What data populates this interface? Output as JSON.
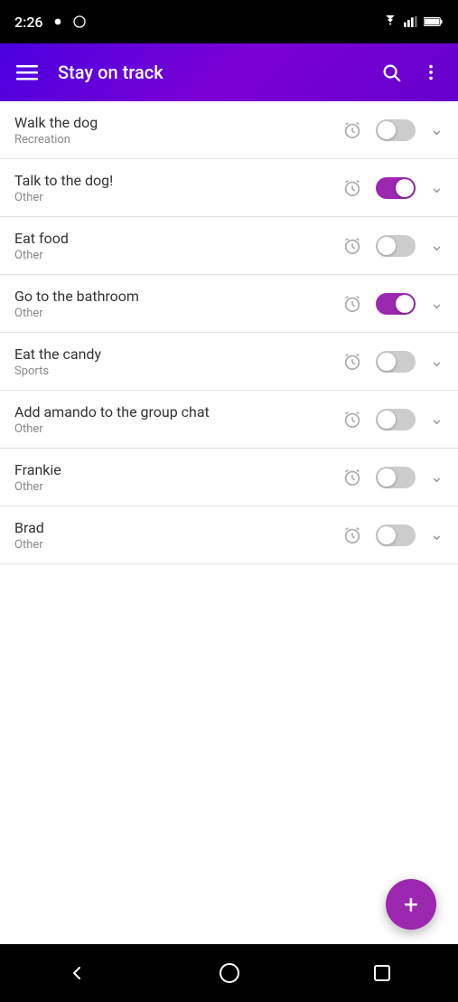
{
  "statusBar": {
    "time": "2:26",
    "icons": [
      "sim",
      "wifi",
      "signal",
      "battery"
    ]
  },
  "appBar": {
    "title": "Stay on track",
    "menuLabel": "☰",
    "searchLabel": "search",
    "moreLabel": "more"
  },
  "tasks": [
    {
      "id": 1,
      "name": "Walk the dog",
      "category": "Recreation",
      "toggleOn": false,
      "hasAlarm": true
    },
    {
      "id": 2,
      "name": "Talk to the dog!",
      "category": "Other",
      "toggleOn": true,
      "hasAlarm": true
    },
    {
      "id": 3,
      "name": "Eat food",
      "category": "Other",
      "toggleOn": false,
      "hasAlarm": true
    },
    {
      "id": 4,
      "name": "Go to the bathroom",
      "category": "Other",
      "toggleOn": true,
      "hasAlarm": true
    },
    {
      "id": 5,
      "name": "Eat the candy",
      "category": "Sports",
      "toggleOn": false,
      "hasAlarm": true
    },
    {
      "id": 6,
      "name": "Add amando to the group chat",
      "category": "Other",
      "toggleOn": false,
      "hasAlarm": true
    },
    {
      "id": 7,
      "name": "Frankie",
      "category": "Other",
      "toggleOn": false,
      "hasAlarm": true
    },
    {
      "id": 8,
      "name": "Brad",
      "category": "Other",
      "toggleOn": false,
      "hasAlarm": true
    }
  ],
  "fab": {
    "label": "+"
  },
  "bottomNav": {
    "back": "◁",
    "home": "○",
    "recent": "□"
  }
}
